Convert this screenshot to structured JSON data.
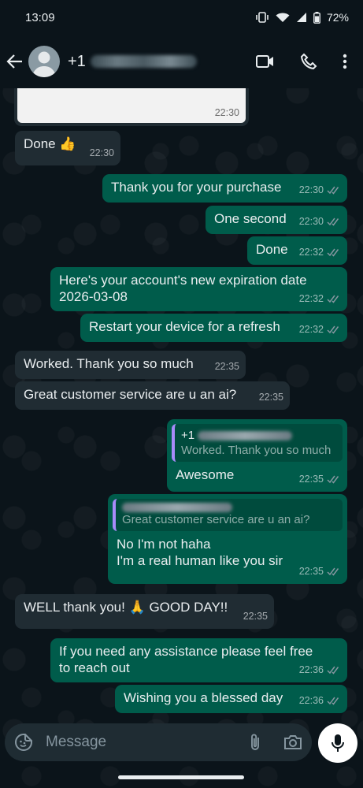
{
  "status_bar": {
    "time": "13:09",
    "battery": "72%"
  },
  "header": {
    "contact_prefix": "+1"
  },
  "image_message": {
    "time": "22:30"
  },
  "messages": [
    {
      "dir": "in",
      "text": "Done 👍",
      "time": "22:30"
    },
    {
      "dir": "out",
      "text": "Thank you for your purchase",
      "time": "22:30"
    },
    {
      "dir": "out",
      "text": "One second",
      "time": "22:30"
    },
    {
      "dir": "out",
      "text": "Done",
      "time": "22:32"
    },
    {
      "dir": "out",
      "line1": "Here's your account's new expiration date",
      "line2": "2026-03-08",
      "time": "22:32"
    },
    {
      "dir": "out",
      "text": "Restart your device for a refresh",
      "time": "22:32"
    },
    {
      "dir": "in",
      "text": "Worked. Thank you so much",
      "time": "22:35"
    },
    {
      "dir": "in",
      "text": "Great customer service are u an ai?",
      "time": "22:35"
    },
    {
      "dir": "out",
      "quote_author": "+1",
      "quote_text": "Worked. Thank you so much",
      "text": "Awesome",
      "time": "22:35"
    },
    {
      "dir": "out",
      "quote_text": "Great customer service are u an ai?",
      "line1": "No I'm not haha",
      "line2": "I'm a real human like you sir",
      "time": "22:35"
    },
    {
      "dir": "in",
      "text": "WELL thank you! 🙏 GOOD DAY!!",
      "time": "22:35"
    },
    {
      "dir": "out",
      "line1": "If you need any assistance please feel free",
      "line2": "to reach out",
      "time": "22:36"
    },
    {
      "dir": "out",
      "text": "Wishing you a blessed day",
      "time": "22:36"
    }
  ],
  "composer": {
    "placeholder": "Message"
  },
  "icons": {
    "back": "arrow-left-icon",
    "video": "video-camera-icon",
    "call": "phone-icon",
    "more": "more-vertical-icon",
    "sticker": "sticker-icon",
    "attach": "paperclip-icon",
    "camera": "camera-icon",
    "mic": "microphone-icon"
  },
  "colors": {
    "background": "#0b141a",
    "incoming_bubble": "#202c33",
    "outgoing_bubble": "#005c4b",
    "read_ticks": "#8696a0"
  }
}
